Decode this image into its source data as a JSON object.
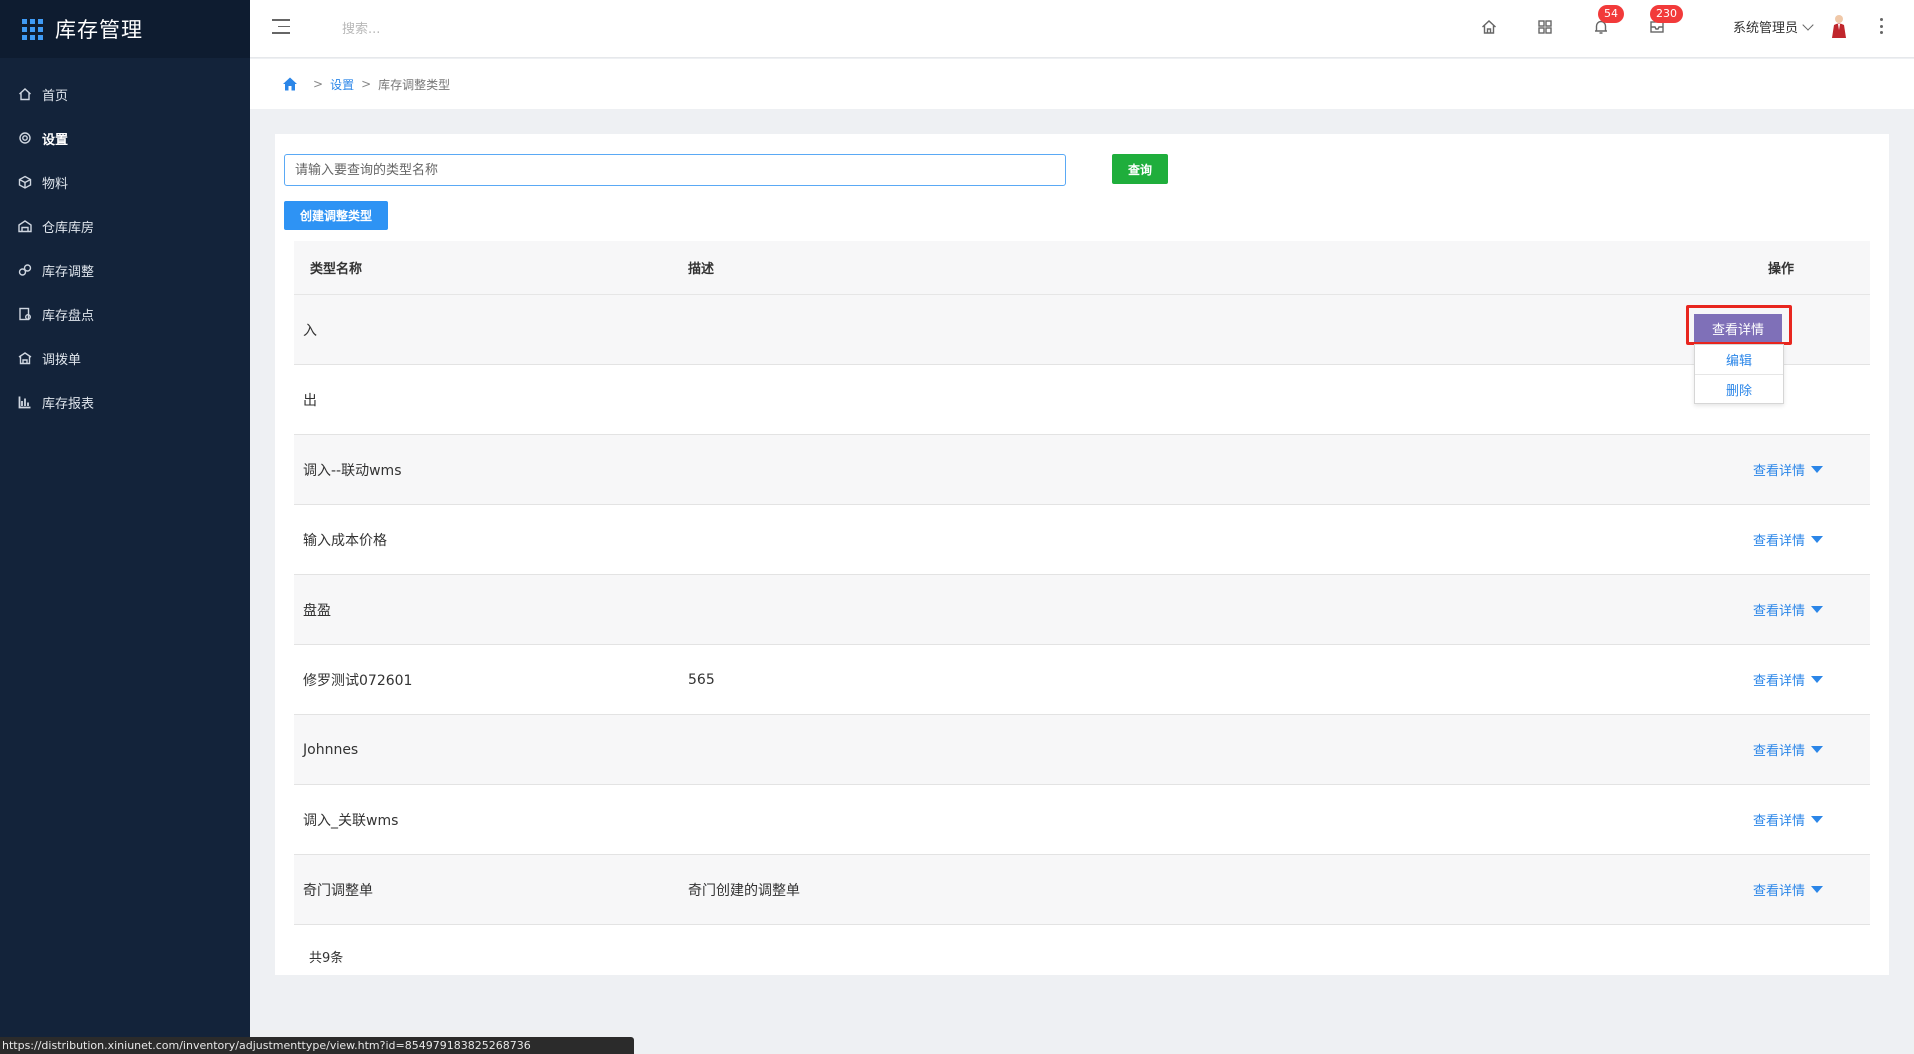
{
  "app": {
    "title": "库存管理"
  },
  "sidebar": {
    "items": [
      {
        "label": "首页",
        "icon": "home-icon"
      },
      {
        "label": "设置",
        "icon": "settings-icon",
        "active": true
      },
      {
        "label": "物料",
        "icon": "cube-icon"
      },
      {
        "label": "仓库库房",
        "icon": "warehouse-icon"
      },
      {
        "label": "库存调整",
        "icon": "adjust-icon"
      },
      {
        "label": "库存盘点",
        "icon": "inventory-check-icon"
      },
      {
        "label": "调拨单",
        "icon": "transfer-icon"
      },
      {
        "label": "库存报表",
        "icon": "bar-chart-icon"
      }
    ]
  },
  "header": {
    "search_placeholder": "搜索...",
    "notifications_count": "54",
    "messages_count": "230",
    "user_name": "系统管理员"
  },
  "breadcrumb": {
    "items": [
      "设置",
      "库存调整类型"
    ]
  },
  "toolbar": {
    "query_placeholder": "请输入要查询的类型名称",
    "query_button": "查询",
    "create_button": "创建调整类型"
  },
  "table": {
    "columns": [
      "类型名称",
      "描述",
      "操作"
    ],
    "rows": [
      {
        "name": "入",
        "desc": ""
      },
      {
        "name": "出",
        "desc": ""
      },
      {
        "name": "调入--联动wms",
        "desc": ""
      },
      {
        "name": "输入成本价格",
        "desc": ""
      },
      {
        "name": "盘盈",
        "desc": ""
      },
      {
        "name": "修罗测试072601",
        "desc": "565"
      },
      {
        "name": "Johnnes",
        "desc": ""
      },
      {
        "name": "调入_关联wms",
        "desc": ""
      },
      {
        "name": "奇门调整单",
        "desc": "奇门创建的调整单"
      }
    ],
    "action_label": "查看详情",
    "total": "共9条"
  },
  "dropdown": {
    "button": "查看详情",
    "items": [
      "编辑",
      "删除"
    ]
  },
  "statusbar": {
    "url": "https://distribution.xiniunet.com/inventory/adjustmenttype/view.htm?id=854979183825268736"
  },
  "colors": {
    "sidebar_bg": "#13233a",
    "accent_blue": "#2e93f4",
    "query_green": "#1fae3c",
    "dropdown_purple": "#7f70b8",
    "highlight_red": "#e8261f",
    "badge_red": "#f23a3a"
  }
}
